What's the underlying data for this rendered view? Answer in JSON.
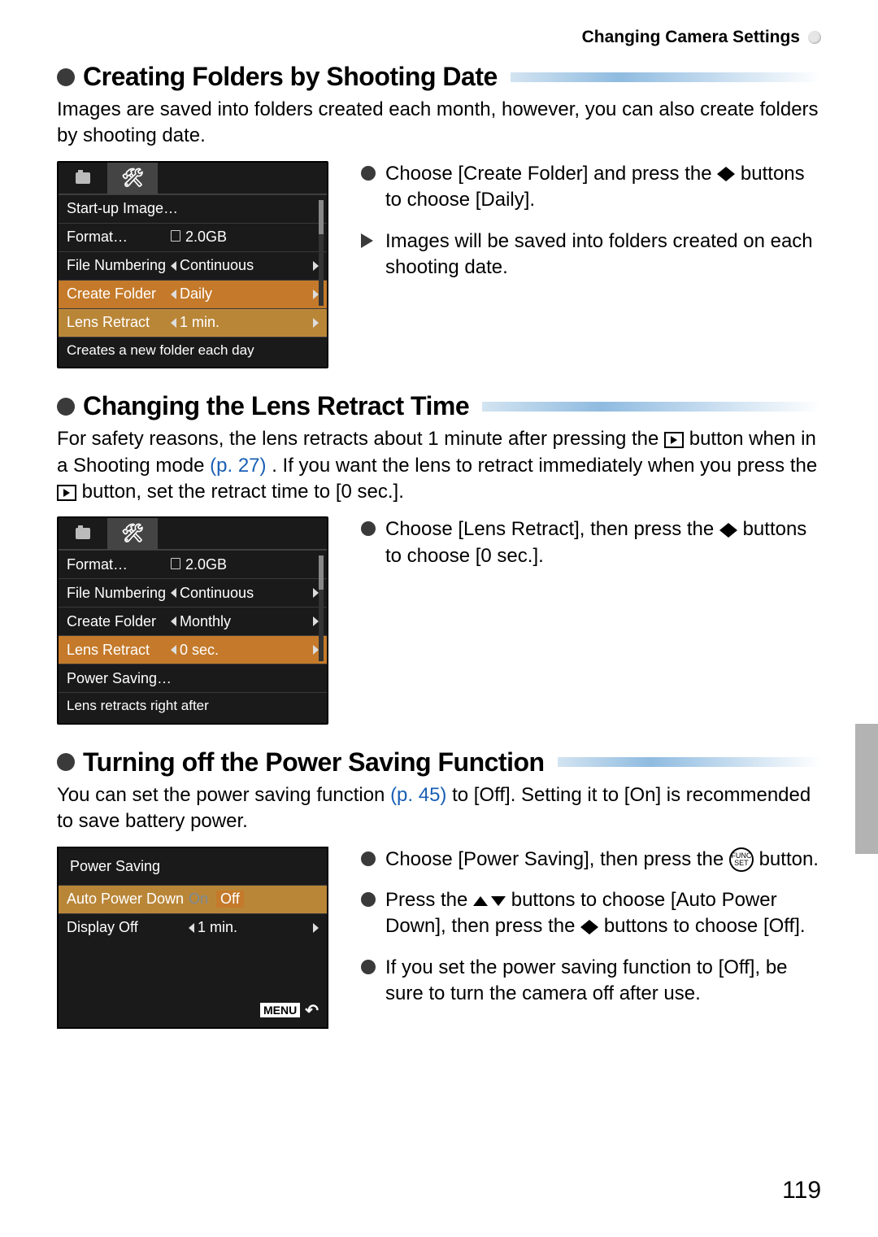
{
  "header": {
    "breadcrumb": "Changing Camera Settings"
  },
  "page_number": "119",
  "sec1": {
    "title": "Creating Folders by Shooting Date",
    "para": "Images are saved into folders created each month, however, you can also create folders by shooting date.",
    "note1a": "Choose [Create Folder] and press the ",
    "note1b": " buttons to choose [Daily].",
    "note2": "Images will be saved into folders created on each shooting date."
  },
  "lcd1": {
    "r1": "Start-up Image…",
    "r2l": "Format…",
    "r2v": "2.0GB",
    "r3l": "File Numbering",
    "r3v": "Continuous",
    "r4l": "Create Folder",
    "r4v": "Daily",
    "r5l": "Lens Retract",
    "r5v": "1 min.",
    "caption": "Creates a new folder each day"
  },
  "sec2": {
    "title": "Changing the Lens Retract Time",
    "para_a": "For safety reasons, the lens retracts about 1 minute after pressing the ",
    "para_b": " button when in a Shooting mode ",
    "para_link": "(p. 27)",
    "para_c": ". If you want the lens to retract immediately when you press the ",
    "para_d": " button, set the retract time to [0 sec.].",
    "note1a": "Choose [Lens Retract], then press the ",
    "note1b": " buttons to choose [0 sec.]."
  },
  "lcd2": {
    "r1l": "Format…",
    "r1v": "2.0GB",
    "r2l": "File Numbering",
    "r2v": "Continuous",
    "r3l": "Create Folder",
    "r3v": "Monthly",
    "r4l": "Lens Retract",
    "r4v": "0 sec.",
    "r5": "Power Saving…",
    "caption": "Lens retracts right after"
  },
  "sec3": {
    "title": "Turning off the Power Saving Function",
    "para_a": "You can set the power saving function ",
    "para_link": "(p. 45)",
    "para_b": " to [Off]. Setting it to [On] is recommended to save battery power.",
    "note1a": "Choose [Power Saving], then press the ",
    "note1b": " button.",
    "note2a": "Press the ",
    "note2b": " buttons to choose [Auto Power Down], then press the ",
    "note2c": " buttons to choose [Off].",
    "note3": "If you set the power saving function to [Off], be sure to turn the camera off after use."
  },
  "lcd3": {
    "title": "Power Saving",
    "r1l": "Auto Power Down",
    "r1on": "On",
    "r1off": "Off",
    "r2l": "Display Off",
    "r2v": "1 min.",
    "menu": "MENU"
  }
}
